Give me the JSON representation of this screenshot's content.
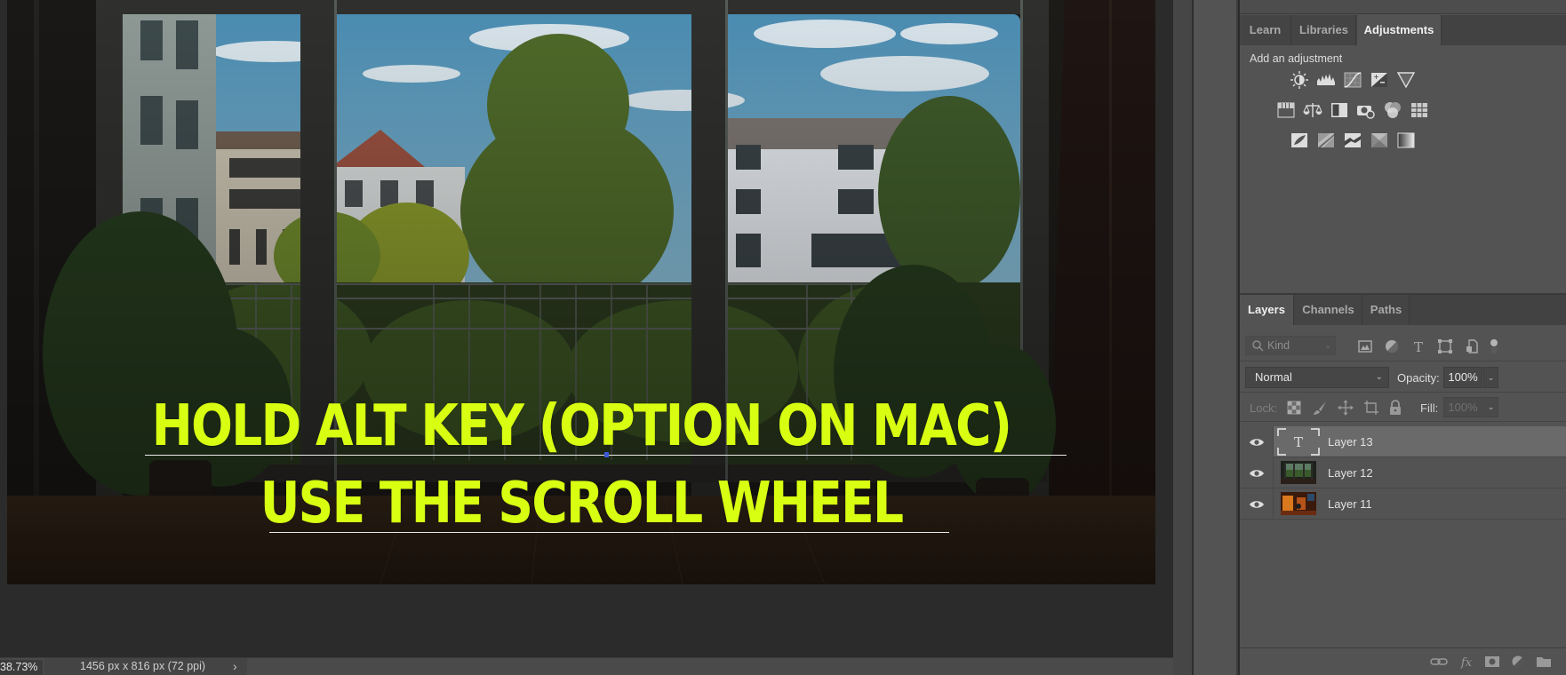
{
  "canvas": {
    "overlay_text": {
      "line1": "HOLD ALT KEY (OPTION ON MAC)",
      "line2": "USE THE SCROLL WHEEL",
      "color": "#d8ff12"
    }
  },
  "status_bar": {
    "zoom": "38.73%",
    "doc_info": "1456 px x 816 px (72 ppi)",
    "chevron_icon": "chevron-right-icon"
  },
  "adjustments_panel": {
    "tabs": [
      {
        "label": "Learn",
        "active": false
      },
      {
        "label": "Libraries",
        "active": false
      },
      {
        "label": "Adjustments",
        "active": true
      }
    ],
    "heading": "Add an adjustment",
    "icons": [
      [
        "brightness-contrast-icon",
        "levels-icon",
        "curves-icon",
        "exposure-icon",
        "vibrance-icon"
      ],
      [
        "hue-saturation-icon",
        "color-balance-icon",
        "black-white-icon",
        "photo-filter-icon",
        "channel-mixer-icon",
        "color-lookup-icon"
      ],
      [
        "invert-icon",
        "posterize-icon",
        "threshold-icon",
        "selective-color-icon",
        "gradient-map-icon"
      ]
    ]
  },
  "layers_panel": {
    "tabs": [
      {
        "label": "Layers",
        "active": true
      },
      {
        "label": "Channels",
        "active": false
      },
      {
        "label": "Paths",
        "active": false
      }
    ],
    "filter": {
      "placeholder": "Kind",
      "icons": [
        "pixel-layer-filter-icon",
        "adjustment-layer-filter-icon",
        "type-layer-filter-icon",
        "shape-layer-filter-icon",
        "smart-object-filter-icon",
        "filter-toggle-icon"
      ]
    },
    "blend_mode": "Normal",
    "opacity_label": "Opacity:",
    "opacity": "100%",
    "lock_label": "Lock:",
    "lock_icons": [
      "lock-transparent-pixels-icon",
      "lock-image-pixels-icon",
      "lock-position-icon",
      "lock-artboard-icon",
      "lock-all-icon"
    ],
    "fill_label": "Fill:",
    "fill": "100%",
    "layers": [
      {
        "name": "Layer 13",
        "type": "text",
        "visible": true,
        "selected": true
      },
      {
        "name": "Layer 12",
        "type": "image",
        "visible": true,
        "selected": false
      },
      {
        "name": "Layer 11",
        "type": "image",
        "visible": true,
        "selected": false
      }
    ],
    "footer_icons": [
      "link-layers-icon",
      "fx-icon",
      "add-mask-icon",
      "new-adjustment-layer-icon",
      "new-group-icon"
    ]
  }
}
